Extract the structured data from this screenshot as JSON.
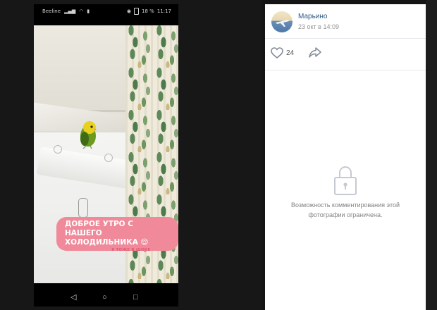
{
  "phone": {
    "status_left": "Beeline",
    "status_battery": "18 %",
    "status_time": "11:17",
    "story_text_line1": "ДОБРОЕ УТРО С НАШЕГО",
    "story_text_line2": "ХОЛОДИЛЬНИКА 😌",
    "story_note": "Я ТОЖЕ В ШОКЕ",
    "nav": {
      "back": "◁",
      "home": "○",
      "recents": "□"
    }
  },
  "post": {
    "author": "Марьино",
    "date": "23 окт в 14:09",
    "likes": "24",
    "comments_blocked_line1": "Возможность комментирования этой",
    "comments_blocked_line2": "фотографии ограничена."
  },
  "colors": {
    "link": "#2a5885",
    "sticker": "#f08a9a",
    "muted": "#939393"
  }
}
